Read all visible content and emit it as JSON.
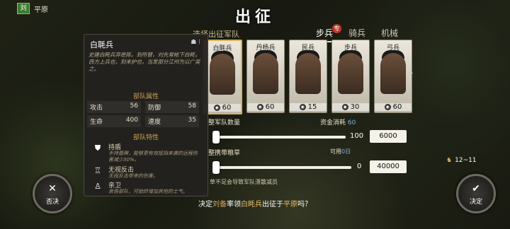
{
  "header": {
    "faction_flag": "刘",
    "region": "平原",
    "title": "出征",
    "select_label": "选择出征军队"
  },
  "tabs": [
    {
      "label": "步兵",
      "badge": "专"
    },
    {
      "label": "骑兵"
    },
    {
      "label": "机械"
    }
  ],
  "roster": [
    {
      "name": "白毦兵",
      "count": "60"
    },
    {
      "name": "丹杨兵",
      "count": "60"
    },
    {
      "name": "民兵",
      "count": "15"
    },
    {
      "name": "步兵",
      "count": "30"
    },
    {
      "name": "弓兵",
      "count": "60"
    }
  ],
  "info": {
    "name": "白毦兵",
    "description": "史建白眊兵弃绝陈。到所替，刘先常帐下白眊，西方上兵也，刻未护也，当发部分江州为以广吴之。",
    "attr_title": "部队属性",
    "stats": {
      "attack": {
        "label": "攻击",
        "value": "56"
      },
      "defense": {
        "label": "防御",
        "value": "58"
      },
      "life": {
        "label": "生命",
        "value": "400"
      },
      "speed": {
        "label": "速度",
        "value": "35"
      }
    },
    "trait_title": "部队特性",
    "traits": [
      {
        "name": "持盾",
        "desc": "手持盾牌，能够更有效抵挡来袭的远程伤害减少30%。"
      },
      {
        "name": "无视反击",
        "desc": "无视反击带来的伤害。"
      },
      {
        "name": "亲卫",
        "desc": "亲信部队，可始终增加其他的士气。"
      }
    ]
  },
  "troop": {
    "label": "整军队数量",
    "cost_label": "资金消耗",
    "cost_value": "60",
    "slider_value": "100",
    "input_value": "6000",
    "slider_fraction": 0.0
  },
  "food": {
    "label": "整携带粮草",
    "usable_label": "可用",
    "usable_value": "0日",
    "slider_value": "0",
    "input_value": "40000",
    "slider_fraction": 0.0
  },
  "note": "草不足会导致军队溃散减员",
  "confirm": {
    "pre": "决定",
    "general": "刘备",
    "mid": "率领",
    "unit": "白眊兵",
    "mid2": "出征于",
    "place": "平原",
    "post": "吗？"
  },
  "buttons": {
    "cancel": "否决",
    "ok": "决定"
  },
  "days": "12~11",
  "colors": {
    "accent": "#d4a85a",
    "selected_border": "#d9b35a",
    "badge": "#c0392b"
  }
}
